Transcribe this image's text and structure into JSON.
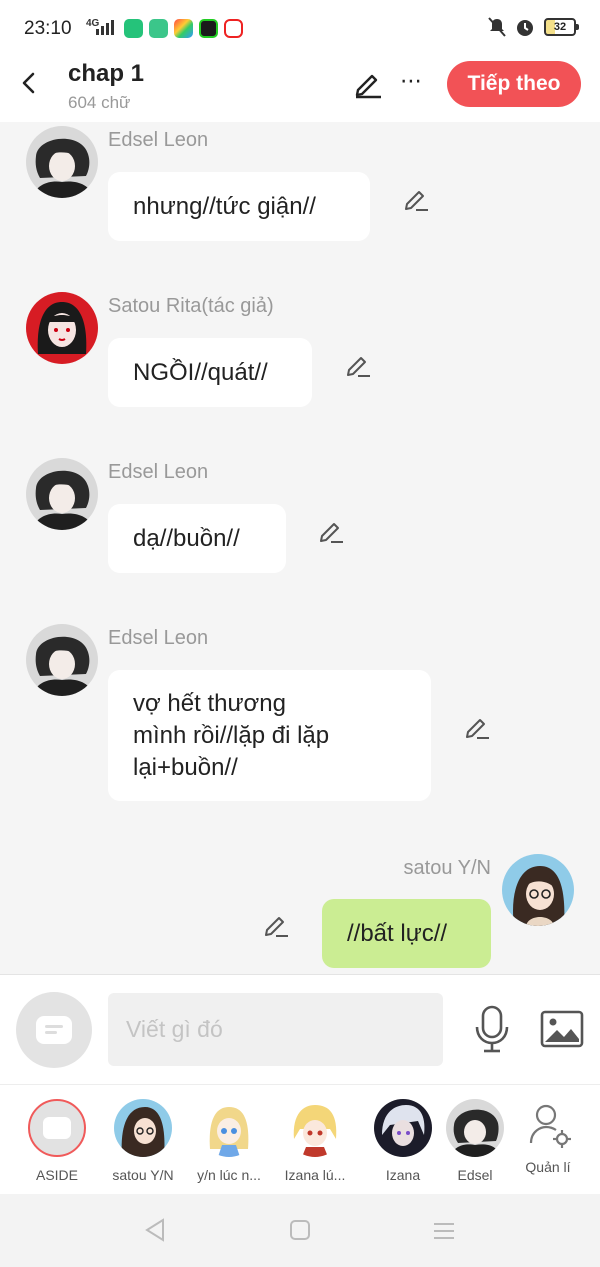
{
  "status_bar": {
    "time": "23:10",
    "network": "4G",
    "battery": "32"
  },
  "header": {
    "title": "chap 1",
    "word_count": "604 chữ",
    "next_button": "Tiếp theo"
  },
  "messages": [
    {
      "sender": "Edsel Leon",
      "text": "nhưng//tức giận//",
      "side": "left",
      "avatar": "edsel"
    },
    {
      "sender": "Satou Rita(tác giả)",
      "text": "NGỒI//quát//",
      "side": "left",
      "avatar": "rita"
    },
    {
      "sender": "Edsel Leon",
      "text": "dạ//buồn//",
      "side": "left",
      "avatar": "edsel"
    },
    {
      "sender": "Edsel Leon",
      "text_lines": [
        "vợ hết thương",
        "mình rồi//lặp đi lặp",
        "lại+buồn//"
      ],
      "side": "left",
      "avatar": "edsel"
    },
    {
      "sender": "satou Y/N",
      "text": "//bất lực//",
      "side": "right",
      "avatar": "yn"
    }
  ],
  "composer": {
    "placeholder": "Viết gì đó"
  },
  "characters": [
    {
      "label": "ASIDE"
    },
    {
      "label": "satou Y/N"
    },
    {
      "label": "y/n lúc n..."
    },
    {
      "label": "Izana lú..."
    },
    {
      "label": "Izana"
    },
    {
      "label": "Edsel"
    },
    {
      "label": "Quản lí"
    }
  ],
  "colors": {
    "accent": "#f25256",
    "my_bubble": "#cbed93",
    "background": "#f5f5f5"
  }
}
